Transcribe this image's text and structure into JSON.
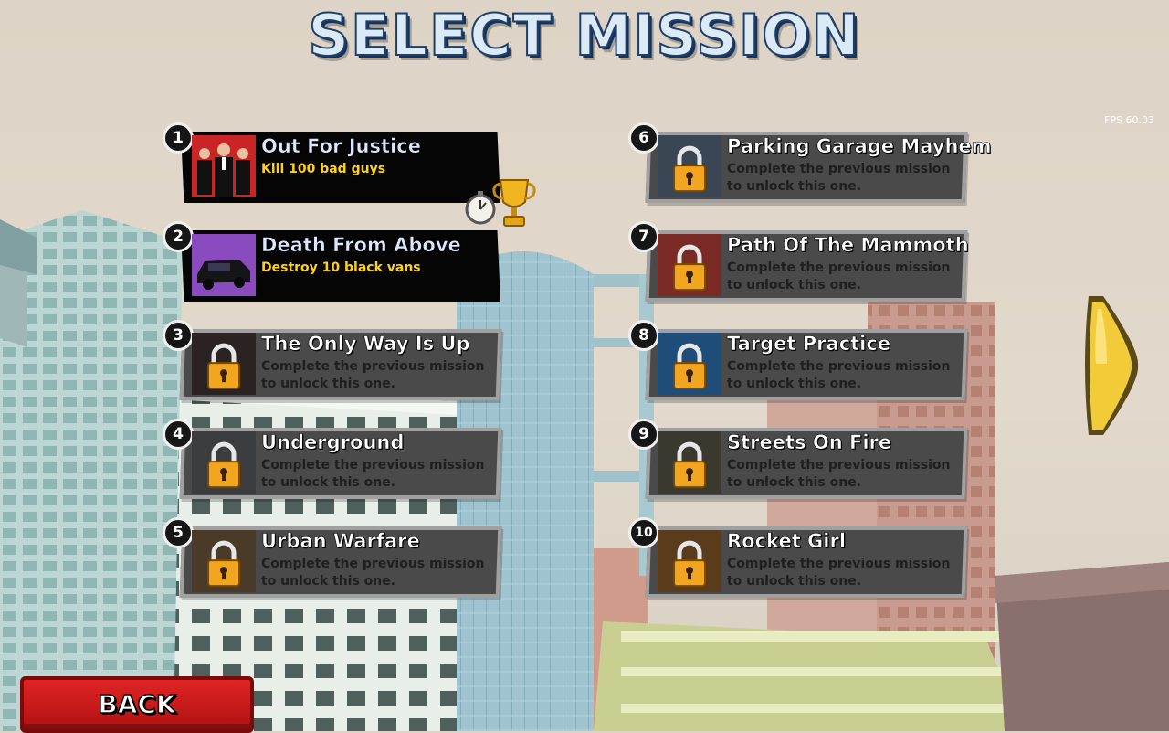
{
  "screen": {
    "title": "SELECT MISSION",
    "fps": "FPS 60.03"
  },
  "colors": {
    "title_fill": "#dbeaf5",
    "title_outline": "#1e3f6a",
    "locked_panel": "#4a4a4a",
    "unlocked_panel": "#050505",
    "desc_unlocked": "#ffd21a",
    "back_button": "#d01818",
    "arrow": "#f0c830"
  },
  "missions": [
    {
      "number": "1",
      "name": "Out For Justice",
      "desc": "Kill 100 bad guys",
      "state": "unlocked",
      "awards": [
        "stopwatch-icon",
        "trophy-icon"
      ]
    },
    {
      "number": "2",
      "name": "Death From Above",
      "desc": "Destroy 10 black vans",
      "state": "unlocked"
    },
    {
      "number": "3",
      "name": "The Only Way Is Up",
      "desc": "Complete the previous mission to unlock this one.",
      "state": "locked"
    },
    {
      "number": "4",
      "name": "Underground",
      "desc": "Complete the previous mission to unlock this one.",
      "state": "locked"
    },
    {
      "number": "5",
      "name": "Urban Warfare",
      "desc": "Complete the previous mission to unlock this one.",
      "state": "locked"
    },
    {
      "number": "6",
      "name": "Parking Garage Mayhem",
      "desc": "Complete the previous mission to unlock this one.",
      "state": "locked"
    },
    {
      "number": "7",
      "name": "Path Of The Mammoth",
      "desc": "Complete the previous mission to unlock this one.",
      "state": "locked"
    },
    {
      "number": "8",
      "name": "Target Practice",
      "desc": "Complete the previous mission to unlock this one.",
      "state": "locked"
    },
    {
      "number": "9",
      "name": "Streets On Fire",
      "desc": "Complete the previous mission to unlock this one.",
      "state": "locked"
    },
    {
      "number": "10",
      "name": "Rocket Girl",
      "desc": "Complete the previous mission to unlock this one.",
      "state": "locked"
    }
  ],
  "buttons": {
    "back": "BACK",
    "next_icon": "arrow-right-icon"
  }
}
